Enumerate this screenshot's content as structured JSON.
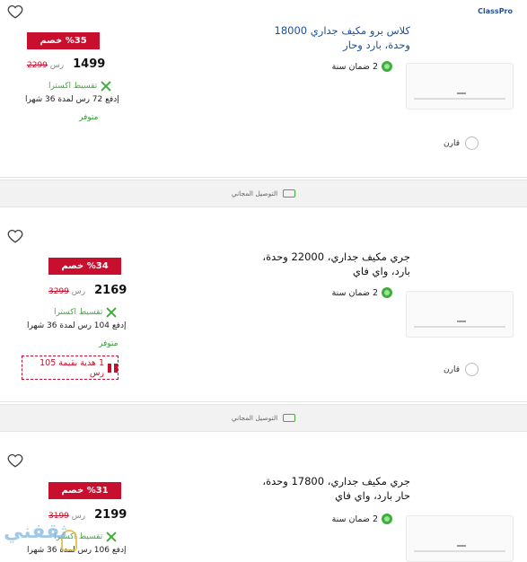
{
  "products": [
    {
      "brand": "ClassPro",
      "title_line1": "كلاس برو مكيف جداري 18000",
      "title_line2": "وحدة، بارد وحار",
      "warranty": "2 ضمان سنة",
      "discount": "%35 خصم",
      "price": "1499",
      "old_price": "2299",
      "currency": "رس",
      "tabby_label": "تقسيط اكسترا",
      "installment": "إدفع 72 رس لمدة 36 شهرا",
      "availability": "متوفر",
      "compare_label": "قارن"
    },
    {
      "title_line1": "جري مكيف جداري، 22000 وحدة،",
      "title_line2": "بارد، واي فاي",
      "warranty": "2 ضمان سنة",
      "discount": "%34 خصم",
      "price": "2169",
      "old_price": "3299",
      "currency": "رس",
      "tabby_label": "تقسيط اكسترا",
      "installment": "إدفع 104 رس لمدة 36 شهرا",
      "availability": "متوفر",
      "gift": "1 هدية بقيمة 105 رس",
      "compare_label": "قارن"
    },
    {
      "title_line1": "جري مكيف جداري، 17800 وحدة،",
      "title_line2": "حار بارد، واي فاي",
      "warranty": "2 ضمان سنة",
      "discount": "%31 خصم",
      "price": "2199",
      "old_price": "3199",
      "currency": "رس",
      "tabby_label": "تقسيط اكسترا",
      "installment": "إدفع 106 رس لمدة 36 شهرا"
    }
  ],
  "delivery_label": "التوصيل المجاني",
  "watermark": "ثقفني",
  "colors": {
    "accent_red": "#c8102e",
    "green": "#3fae3a",
    "link_blue": "#1d4f9c"
  },
  "icons": [
    "heart-icon",
    "warranty-badge-icon",
    "tabby-icon",
    "gift-icon",
    "truck-icon"
  ]
}
